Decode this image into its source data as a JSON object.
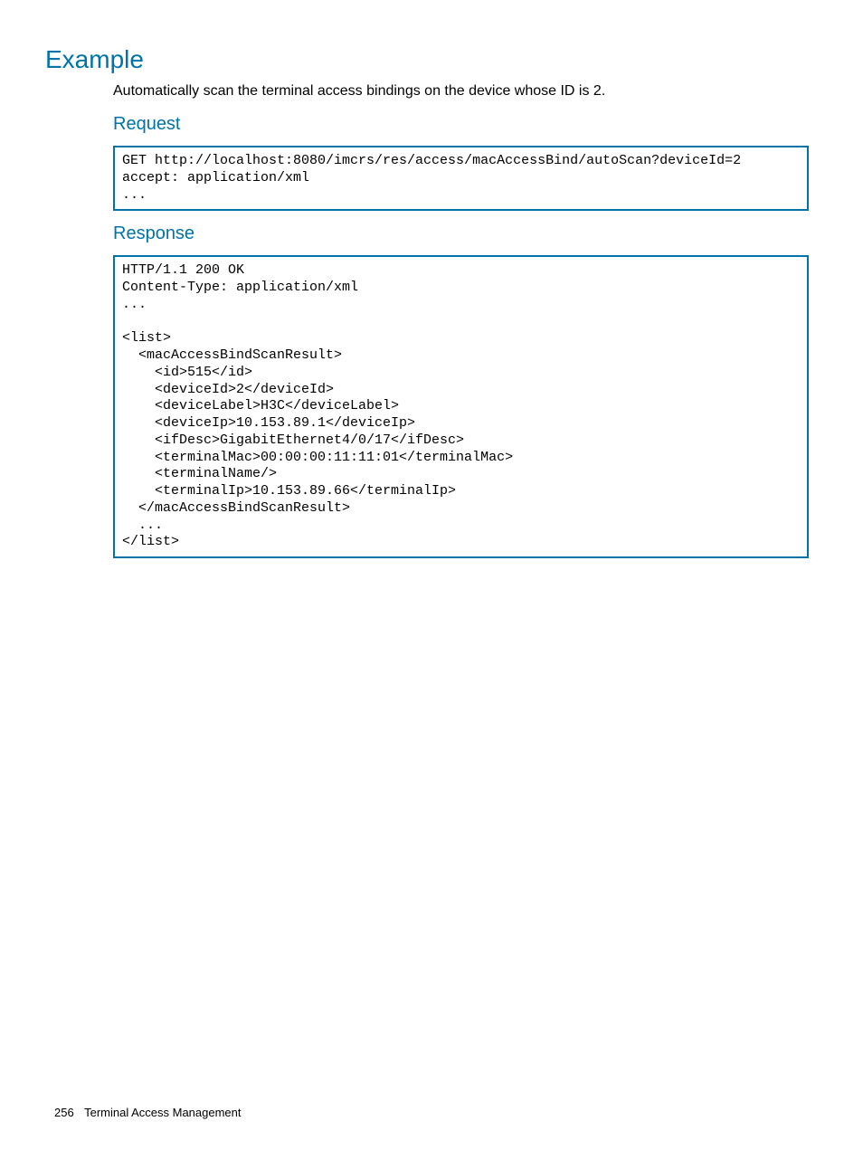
{
  "headings": {
    "example": "Example",
    "request": "Request",
    "response": "Response"
  },
  "intro": "Automatically scan the terminal access bindings on the device whose ID is 2.",
  "request_code": "GET http://localhost:8080/imcrs/res/access/macAccessBind/autoScan?deviceId=2\naccept: application/xml\n...",
  "response_code": "HTTP/1.1 200 OK\nContent-Type: application/xml\n...\n\n<list>\n  <macAccessBindScanResult>\n    <id>515</id>\n    <deviceId>2</deviceId>\n    <deviceLabel>H3C</deviceLabel>\n    <deviceIp>10.153.89.1</deviceIp>\n    <ifDesc>GigabitEthernet4/0/17</ifDesc>\n    <terminalMac>00:00:00:11:11:01</terminalMac>\n    <terminalName/>\n    <terminalIp>10.153.89.66</terminalIp>\n  </macAccessBindScanResult>\n  ...\n</list>",
  "footer": {
    "page_number": "256",
    "section": "Terminal Access Management"
  }
}
